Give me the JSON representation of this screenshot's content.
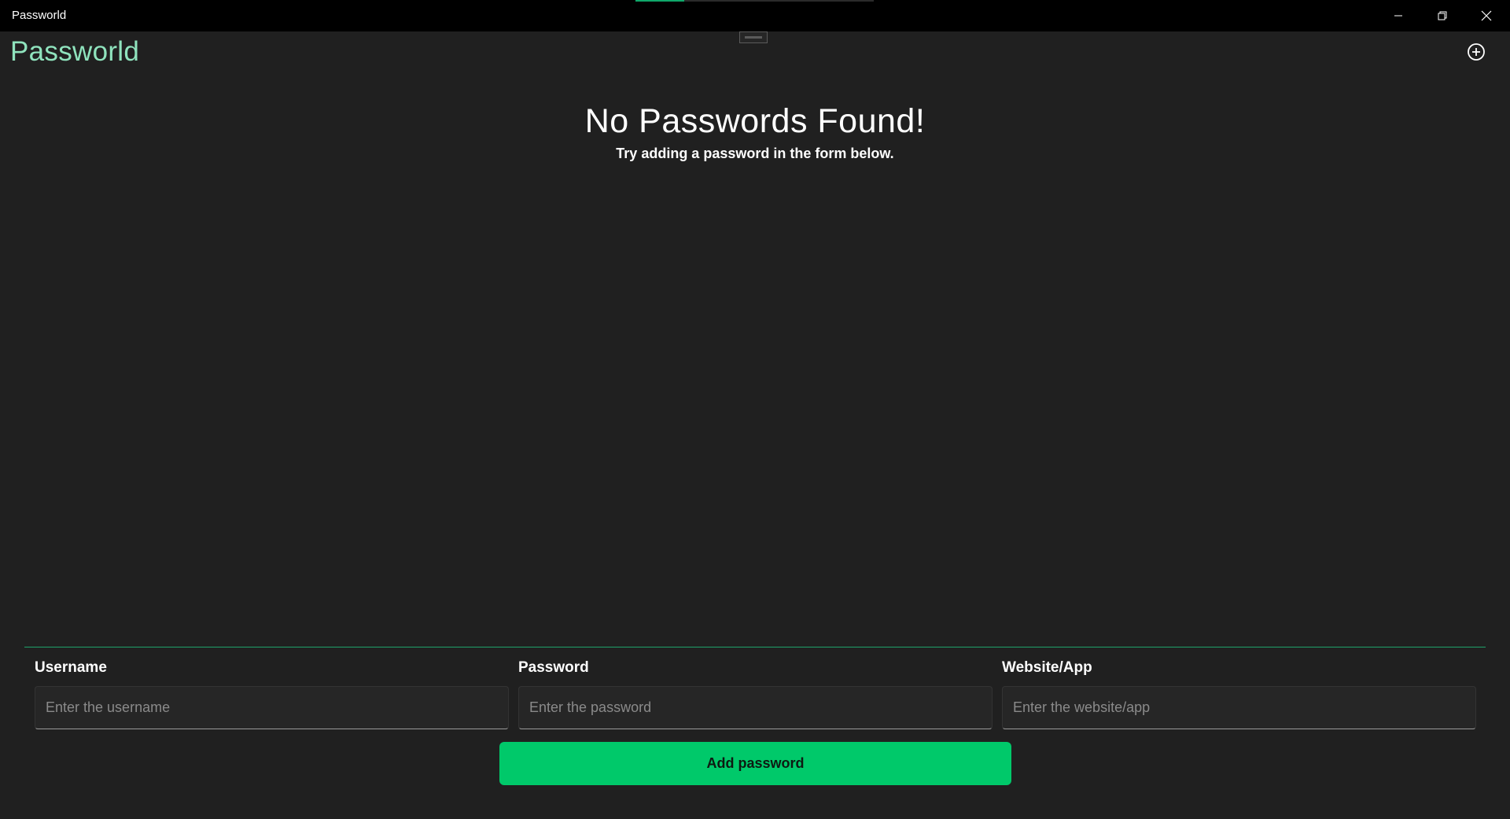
{
  "window": {
    "title": "Passworld"
  },
  "header": {
    "logo": "Passworld",
    "add_icon": "plus-circle-icon",
    "collapse_icon": "drag-handle-icon"
  },
  "empty_state": {
    "title": "No Passwords Found!",
    "subtitle": "Try adding a password in the form below."
  },
  "form": {
    "fields": [
      {
        "label": "Username",
        "placeholder": "Enter the username",
        "value": ""
      },
      {
        "label": "Password",
        "placeholder": "Enter the password",
        "value": ""
      },
      {
        "label": "Website/App",
        "placeholder": "Enter the website/app",
        "value": ""
      }
    ],
    "submit_label": "Add password"
  },
  "colors": {
    "background": "#202020",
    "titlebar": "#000000",
    "logo": "#8fe3bd",
    "accent": "#00c96a",
    "divider": "#1fa36a"
  }
}
